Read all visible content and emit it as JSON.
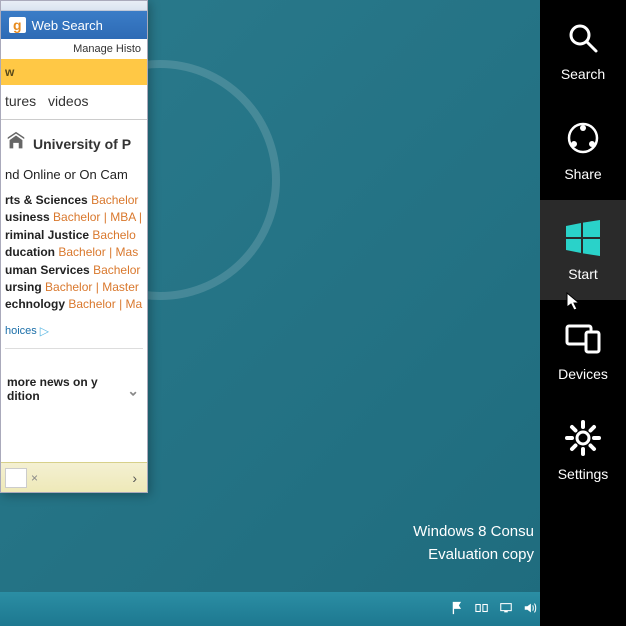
{
  "browser": {
    "search_tab": "Web Search",
    "search_g": "g",
    "manage": "Manage Histo",
    "ow": "w",
    "nav": {
      "tab1": "tures",
      "tab2": "videos"
    },
    "uni_name": "University of P",
    "online": "nd Online or On Cam",
    "programs": [
      {
        "cat": "rts & Sciences",
        "deg1": "Bachelor"
      },
      {
        "cat": "usiness",
        "deg1": "Bachelor",
        "deg2": "MBA"
      },
      {
        "cat": "riminal Justice",
        "deg1": "Bachelo"
      },
      {
        "cat": "ducation",
        "deg1": "Bachelor",
        "deg2": "Mas"
      },
      {
        "cat": "uman Services",
        "deg1": "Bachelor"
      },
      {
        "cat": "ursing",
        "deg1": "Bachelor",
        "deg2": "Master"
      },
      {
        "cat": "echnology",
        "deg1": "Bachelor",
        "deg2": "Ma"
      }
    ],
    "adchoices": "hoices",
    "news1": "more news on y",
    "news2": "dition",
    "close_x": "×"
  },
  "watermark": {
    "line1": "Windows 8 Consu",
    "line2": "Evaluation copy"
  },
  "charms": {
    "search": "Search",
    "share": "Share",
    "start": "Start",
    "devices": "Devices",
    "settings": "Settings"
  }
}
